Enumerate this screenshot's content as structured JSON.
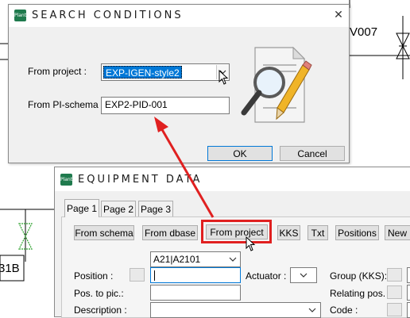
{
  "background": {
    "tag_top_right": "V007",
    "tag_left": "31B"
  },
  "search_dialog": {
    "app_icon": "Plant",
    "title": "SEARCH CONDITIONS",
    "close_glyph": "✕",
    "from_project_label": "From project :",
    "from_project_value": "EXP-IGEN-style2",
    "from_pi_schema_label": "From PI-schema :",
    "from_pi_schema_value": "EXP2-PID-001",
    "ok_label": "OK",
    "cancel_label": "Cancel",
    "illustration": "document-search-pencil-icon"
  },
  "equipment_dialog": {
    "app_icon": "Plant",
    "title": "EQUIPMENT DATA",
    "tabs": [
      "Page 1",
      "Page 2",
      "Page 3"
    ],
    "active_tab": "Page 1",
    "toolbar": [
      "From schema",
      "From dbase",
      "From project",
      "KKS",
      "Txt",
      "Positions",
      "New p"
    ],
    "highlighted_button": "From project",
    "position_label": "Position :",
    "position_dropdown_value": "A21|A2101",
    "position_value": "",
    "actuator_label": "Actuator :",
    "group_label": "Group (KKS):",
    "pos_to_pic_label": "Pos. to pic.:",
    "relating_pos_label": "Relating pos. :",
    "description_label": "Description :",
    "code_label": "Code :"
  },
  "colors": {
    "annotation_red": "#e02020",
    "titlebar_active": "#ffffff",
    "dialog_bg": "#f0f0f0",
    "selection": "#0078d7",
    "icon_green": "#1f7a4d"
  }
}
